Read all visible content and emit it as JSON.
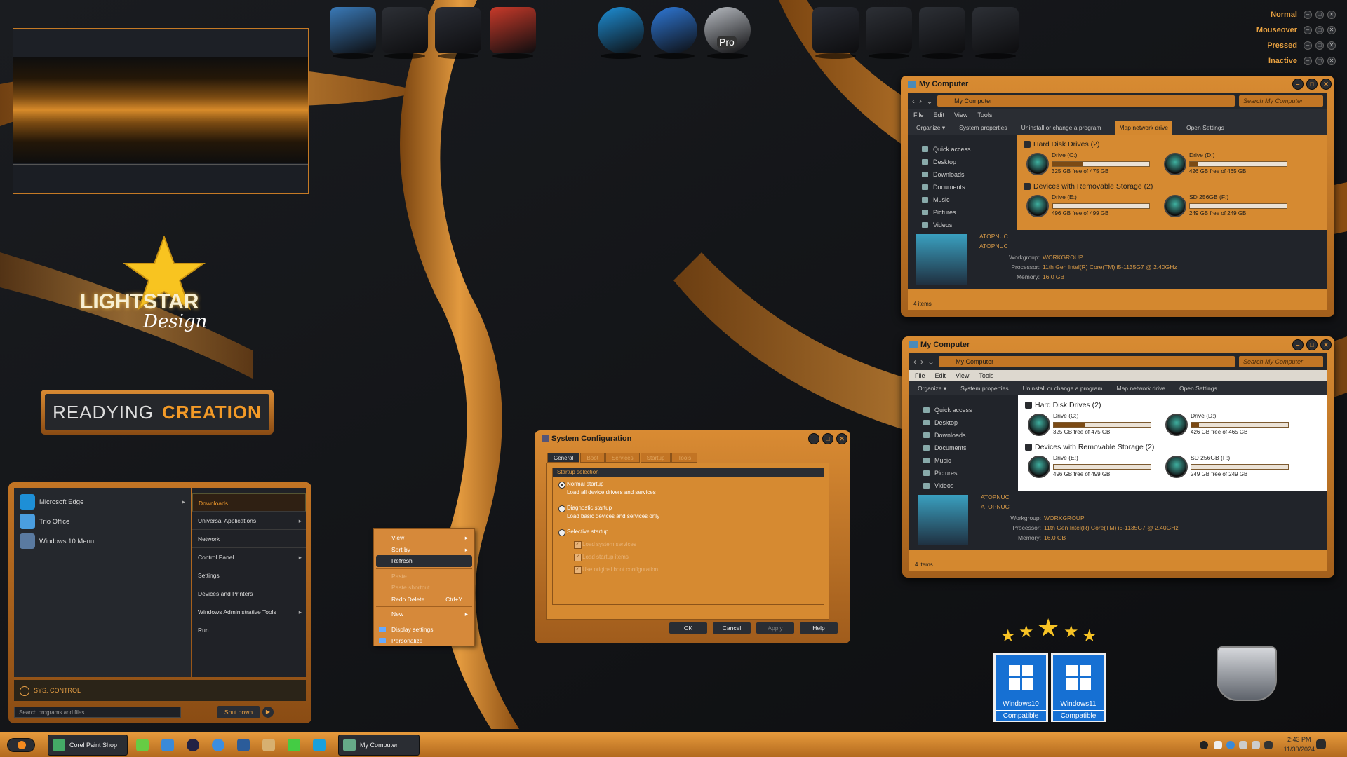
{
  "caption_states": [
    "Normal",
    "Mouseover",
    "Pressed",
    "Inactive"
  ],
  "branding": {
    "logo_text_1": "LIGHTSTAR",
    "logo_text_2": "Design",
    "ready_text_1": "READYING",
    "ready_text_2": "CREATION"
  },
  "dock_icons": [
    "computer-icon",
    "laptop-icon",
    "server-icon",
    "task-manager-icon",
    "edge-icon",
    "thunderbird-icon",
    "pro-icon",
    "server-icon",
    "laptop-icon",
    "laptop-icon",
    "laptop-icon"
  ],
  "dock_badge": "Pro",
  "explorer_windows": [
    {
      "title": "My Computer",
      "path": "My Computer",
      "search_placeholder": "Search My Computer",
      "menu": [
        "File",
        "Edit",
        "View",
        "Tools"
      ],
      "toolbar": [
        "Organize ▾",
        "System properties",
        "Uninstall or change a program",
        "Map network drive",
        "Open Settings"
      ],
      "nav": [
        "Quick access",
        "Desktop",
        "Downloads",
        "Documents",
        "Music",
        "Pictures",
        "Videos"
      ],
      "groups": [
        {
          "label": "Hard Disk Drives (2)",
          "drives": [
            {
              "name": "Drive (C:)",
              "free": "325 GB free of 475 GB",
              "used": 0.32
            },
            {
              "name": "Drive (D:)",
              "free": "426 GB free of 465 GB",
              "used": 0.08
            }
          ]
        },
        {
          "label": "Devices with Removable Storage (2)",
          "drives": [
            {
              "name": "Drive (E:)",
              "free": "496 GB free of 499 GB",
              "used": 0.01
            },
            {
              "name": "SD 256GB (F:)",
              "free": "249 GB free of 249 GB",
              "used": 0.0
            }
          ]
        }
      ],
      "pc_name": "ATOPNUC",
      "pc_name_2": "ATOPNUC",
      "workgroup_key": "Workgroup:",
      "workgroup": "WORKGROUP",
      "processor_key": "Processor:",
      "processor": "11th Gen Intel(R) Core(TM) i5-1135G7 @ 2.40GHz",
      "memory_key": "Memory:",
      "memory": "16.0 GB",
      "status": "4 items"
    }
  ],
  "start_menu": {
    "apps": [
      {
        "label": "Microsoft Edge",
        "color": "#1e8fd6",
        "arrow": "▸"
      },
      {
        "label": "Trio Office",
        "color": "#4a9ee0",
        "arrow": ""
      },
      {
        "label": "Windows 10 Menu",
        "color": "#5a7aa0",
        "arrow": ""
      }
    ],
    "right": [
      {
        "label": "Downloads",
        "arrow": "",
        "sel": true,
        "sep": true
      },
      {
        "label": "Universal Applications",
        "arrow": "▸",
        "sel": false,
        "sep": true
      },
      {
        "label": "Network",
        "arrow": "",
        "sel": false,
        "sep": true
      },
      {
        "label": "Control Panel",
        "arrow": "▸",
        "sel": false,
        "sep": false
      },
      {
        "label": "Settings",
        "arrow": "",
        "sel": false,
        "sep": false
      },
      {
        "label": "Devices and Printers",
        "arrow": "",
        "sel": false,
        "sep": false
      },
      {
        "label": "Windows Administrative Tools",
        "arrow": "▸",
        "sel": false,
        "sep": false
      },
      {
        "label": "Run...",
        "arrow": "",
        "sel": false,
        "sep": false
      }
    ],
    "sys_control": "SYS. CONTROL",
    "search_placeholder": "Search programs and files",
    "shutdown": "Shut down"
  },
  "context_menu": [
    {
      "label": "View",
      "arrow": "▸"
    },
    {
      "label": "Sort by",
      "arrow": "▸"
    },
    {
      "label": "Refresh",
      "sel": true
    },
    {
      "sep": true
    },
    {
      "label": "Paste",
      "dis": true
    },
    {
      "label": "Paste shortcut",
      "dis": true
    },
    {
      "label": "Redo Delete",
      "shortcut": "Ctrl+Y"
    },
    {
      "sep": true
    },
    {
      "label": "New",
      "arrow": "▸"
    },
    {
      "sep": true
    },
    {
      "label": "Display settings",
      "icon": true
    },
    {
      "label": "Personalize",
      "icon": true
    }
  ],
  "sysconfig": {
    "title": "System Configuration",
    "tabs": [
      "General",
      "Boot",
      "Services",
      "Startup",
      "Tools"
    ],
    "group": "Startup selection",
    "normal": "Normal startup",
    "normal_desc": "Load all device drivers and services",
    "diag": "Diagnostic startup",
    "diag_desc": "Load basic devices and services only",
    "sel": "Selective startup",
    "checks": [
      "Load system services",
      "Load startup items",
      "Use original boot configuration"
    ],
    "buttons": [
      "OK",
      "Cancel",
      "Apply",
      "Help"
    ]
  },
  "compat": [
    {
      "name": "Windows10",
      "label": "Compatible"
    },
    {
      "name": "Windows11",
      "label": "Compatible"
    }
  ],
  "taskbar": {
    "buttons": [
      "Corel Paint Shop P...",
      "My Computer"
    ],
    "time": "2:43 PM",
    "date": "11/30/2024"
  },
  "colors": {
    "accent": "#d8892f",
    "dark": "#21242a",
    "text_orange": "#e7a040"
  }
}
